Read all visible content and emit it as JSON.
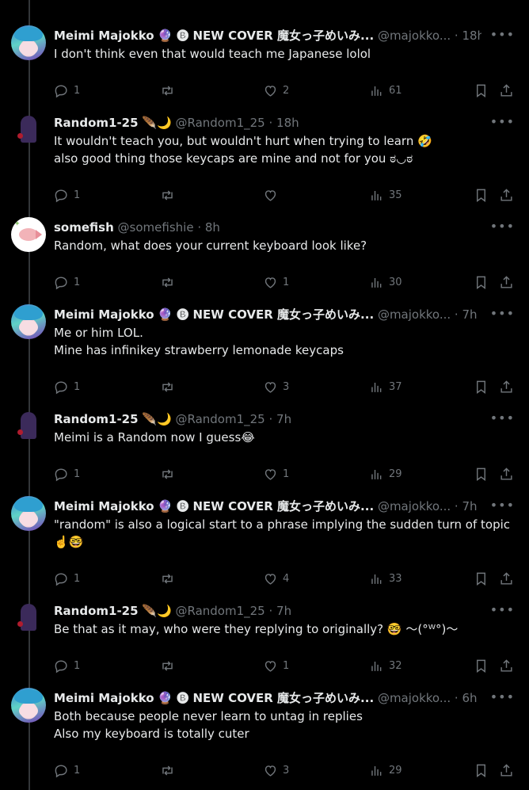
{
  "posts": [
    {
      "author": "Meimi Majokko",
      "badge": "🔮 🅑 NEW COVER 魔女っ子めいみ...",
      "handle": "@majokko...",
      "time": "18h",
      "text": "I don't think even that would teach me Japanese lolol",
      "replies": "1",
      "reposts": "",
      "likes": "2",
      "views": "61",
      "avatar": "meimi"
    },
    {
      "author": "Random1-25",
      "badge": "🪶🌙",
      "handle": "@Random1_25",
      "time": "18h",
      "text": "It wouldn't teach you, but wouldn't hurt when trying to learn 🤣\nalso good thing those keycaps are mine and not for you ಠ◡ಠ",
      "replies": "1",
      "reposts": "",
      "likes": "",
      "views": "35",
      "avatar": "random"
    },
    {
      "author": "somefish",
      "badge": "",
      "handle": "@somefishie",
      "time": "8h",
      "text": "Random, what does your current keyboard look like?",
      "replies": "1",
      "reposts": "",
      "likes": "1",
      "views": "30",
      "avatar": "fish"
    },
    {
      "author": "Meimi Majokko",
      "badge": "🔮 🅑 NEW COVER 魔女っ子めいみ...",
      "handle": "@majokko...",
      "time": "7h",
      "text": "Me or him LOL.\nMine has infinikey strawberry lemonade keycaps",
      "replies": "1",
      "reposts": "",
      "likes": "3",
      "views": "37",
      "avatar": "meimi"
    },
    {
      "author": "Random1-25",
      "badge": "🪶🌙",
      "handle": "@Random1_25",
      "time": "7h",
      "text": "Meimi is a Random now I guess😂",
      "replies": "1",
      "reposts": "",
      "likes": "1",
      "views": "29",
      "avatar": "random"
    },
    {
      "author": "Meimi Majokko",
      "badge": "🔮 🅑 NEW COVER 魔女っ子めいみ...",
      "handle": "@majokko...",
      "time": "7h",
      "text": "\"random\" is also a logical start to a phrase implying the sudden turn of topic ☝️🤓",
      "replies": "1",
      "reposts": "",
      "likes": "4",
      "views": "33",
      "avatar": "meimi"
    },
    {
      "author": "Random1-25",
      "badge": "🪶🌙",
      "handle": "@Random1_25",
      "time": "7h",
      "text": "Be that as it may, who were they replying to originally? 🤓 ～(°ᵂ°)～",
      "replies": "1",
      "reposts": "",
      "likes": "1",
      "views": "32",
      "avatar": "random"
    },
    {
      "author": "Meimi Majokko",
      "badge": "🔮 🅑 NEW COVER 魔女っ子めいみ...",
      "handle": "@majokko...",
      "time": "6h",
      "text": "Both because people never learn to untag in replies\nAlso my keyboard is totally cuter",
      "replies": "1",
      "reposts": "",
      "likes": "3",
      "views": "29",
      "avatar": "meimi"
    }
  ],
  "ui": {
    "more_glyph": "•••",
    "dot": "·"
  }
}
